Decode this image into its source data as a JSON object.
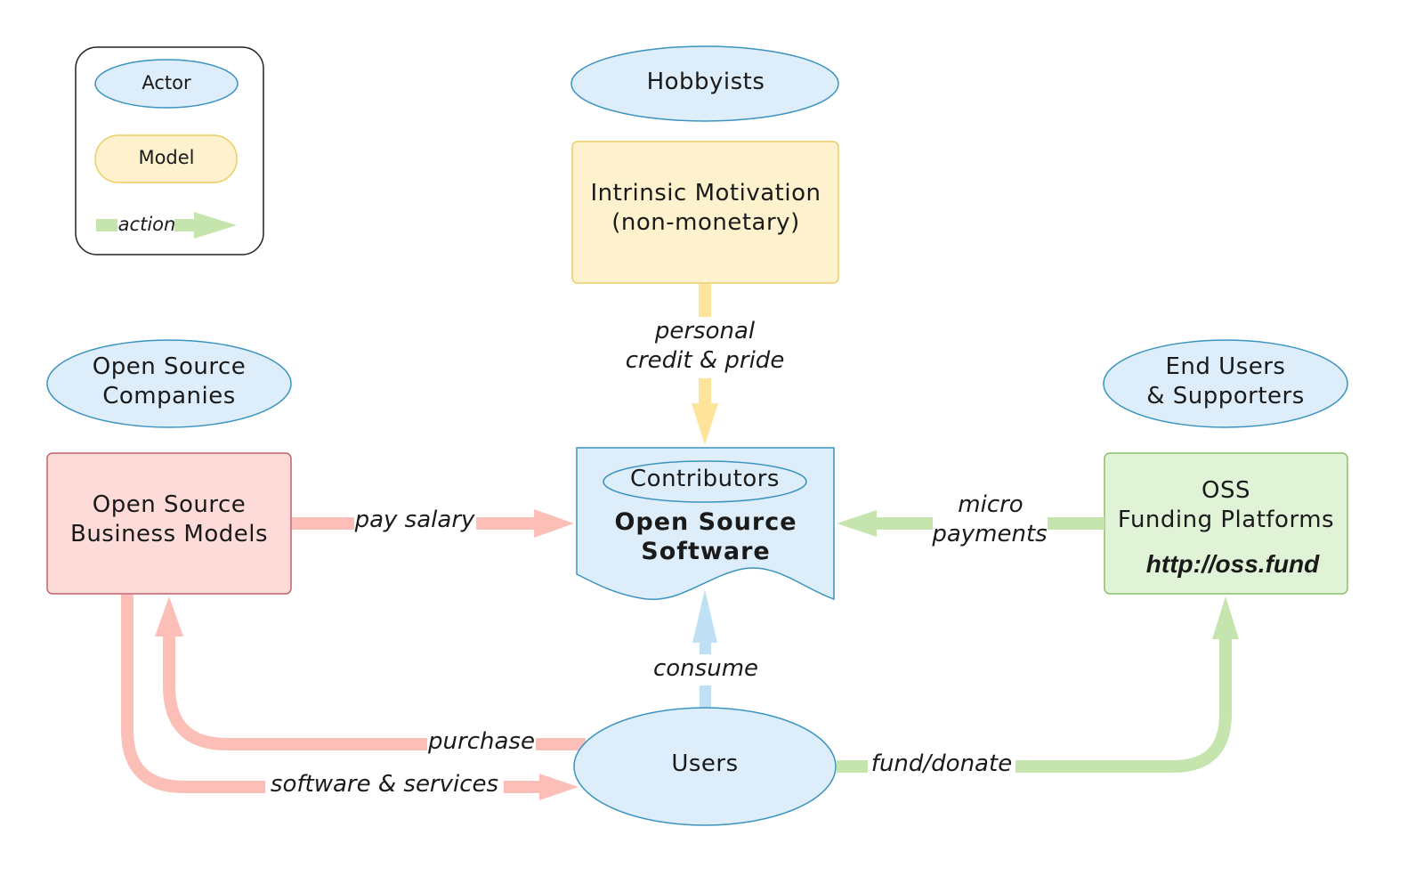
{
  "legend": {
    "actor_label": "Actor",
    "model_label": "Model",
    "action_label": "action"
  },
  "actors": {
    "hobbyists": "Hobbyists",
    "companies": [
      "Open Source",
      "Companies"
    ],
    "end_users": [
      "End Users",
      "& Supporters"
    ],
    "contributors": "Contributors",
    "users": "Users"
  },
  "models": {
    "intrinsic": [
      "Intrinsic Motivation",
      "(non-monetary)"
    ],
    "business": [
      "Open Source",
      "Business Models"
    ],
    "oss": [
      "Open Source",
      "Software"
    ],
    "funding": [
      "OSS",
      "Funding Platforms"
    ],
    "funding_url": "http://oss.fund"
  },
  "actions": {
    "personal": [
      "personal",
      "credit & pride"
    ],
    "pay_salary": "pay salary",
    "micro": [
      "micro",
      "payments"
    ],
    "consume": "consume",
    "purchase": "purchase",
    "software_services": "software & services",
    "fund_donate": "fund/donate"
  },
  "colors": {
    "actor_fill": "#ddeefa",
    "actor_stroke": "#3a93c0",
    "yellow_fill": "#fdf2cd",
    "yellow_stroke": "#eccd64",
    "yellow_arrow": "#fde49a",
    "red_fill": "#fddbd8",
    "red_stroke": "#c0626c",
    "red_arrow": "#fbbfb8",
    "green_fill": "#e1f3d6",
    "green_stroke": "#8bbf6e",
    "green_arrow": "#c6e5ae",
    "blue_arrow": "#bfe0f5"
  }
}
